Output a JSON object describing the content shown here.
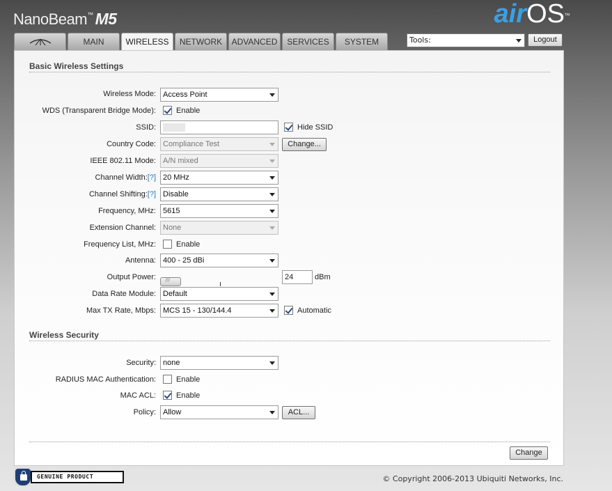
{
  "header": {
    "brand": "NanoBeam",
    "brand_tm": "™",
    "model": "M5",
    "logo_air": "air",
    "logo_os": "OS",
    "logo_tm": "™"
  },
  "tabs": [
    {
      "label": "",
      "icon": "ubiquiti-logo-icon"
    },
    {
      "label": "MAIN"
    },
    {
      "label": "WIRELESS",
      "active": true
    },
    {
      "label": "NETWORK"
    },
    {
      "label": "ADVANCED"
    },
    {
      "label": "SERVICES"
    },
    {
      "label": "SYSTEM"
    }
  ],
  "tools": {
    "value": "Tools:"
  },
  "logout": "Logout",
  "basic": {
    "title": "Basic Wireless Settings",
    "wireless_mode": {
      "label": "Wireless Mode:",
      "value": "Access Point"
    },
    "wds": {
      "label": "WDS (Transparent Bridge Mode):",
      "checkbox": "Enable",
      "checked": true
    },
    "ssid": {
      "label": "SSID:",
      "value": "",
      "hide_label": "Hide SSID",
      "hide_checked": true
    },
    "country": {
      "label": "Country Code:",
      "value": "Compliance Test",
      "button": "Change..."
    },
    "ieee": {
      "label": "IEEE 802.11 Mode:",
      "value": "A/N mixed"
    },
    "channel_width": {
      "label": "Channel Width:",
      "help": "[?]",
      "value": "20 MHz"
    },
    "channel_shifting": {
      "label": "Channel Shifting:",
      "help": "[?]",
      "value": "Disable"
    },
    "frequency": {
      "label": "Frequency, MHz:",
      "value": "5615"
    },
    "extension": {
      "label": "Extension Channel:",
      "value": "None"
    },
    "freq_list": {
      "label": "Frequency List, MHz:",
      "checkbox": "Enable",
      "checked": false
    },
    "antenna": {
      "label": "Antenna:",
      "value": "400 - 25 dBi"
    },
    "output_power": {
      "label": "Output Power:",
      "value": "24",
      "unit": "dBm"
    },
    "data_rate": {
      "label": "Data Rate Module:",
      "value": "Default"
    },
    "max_tx": {
      "label": "Max TX Rate, Mbps:",
      "value": "MCS 15 - 130/144.4",
      "auto_label": "Automatic",
      "auto_checked": true
    }
  },
  "security": {
    "title": "Wireless Security",
    "security": {
      "label": "Security:",
      "value": "none"
    },
    "radius": {
      "label": "RADIUS MAC Authentication:",
      "checkbox": "Enable",
      "checked": false
    },
    "mac_acl": {
      "label": "MAC ACL:",
      "checkbox": "Enable",
      "checked": true
    },
    "policy": {
      "label": "Policy:",
      "value": "Allow",
      "button": "ACL..."
    }
  },
  "change_button": "Change",
  "footer": {
    "copyright": "© Copyright 2006-2013 Ubiquiti Networks, Inc.",
    "badge_text": "GENUINE  PRODUCT"
  }
}
